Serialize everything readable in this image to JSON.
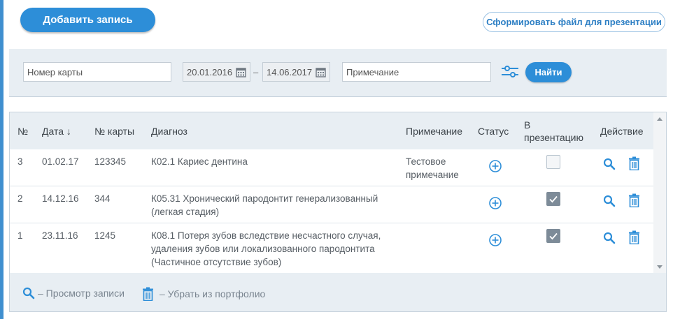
{
  "toolbar": {
    "add_label": "Добавить запись",
    "presentation_label": "Сформировать файл для презентации"
  },
  "filters": {
    "card_placeholder": "Номер карты",
    "date_from": "20.01.2016",
    "date_separator": "–",
    "date_to": "14.06.2017",
    "note_placeholder": "Примечание",
    "find_label": "Найти"
  },
  "table": {
    "headers": {
      "num": "№",
      "date": "Дата ↓",
      "card": "№ карты",
      "diagnosis": "Диагноз",
      "note": "Примечание",
      "status": "Статус",
      "presentation_line1": "В",
      "presentation_line2": "презентацию",
      "action": "Действие"
    },
    "rows": [
      {
        "num": "3",
        "date": "01.02.17",
        "card": "123345",
        "diagnosis_lines": [
          "К02.1 Кариес дентина"
        ],
        "note_lines": [
          "Тестовое",
          "примечание"
        ],
        "in_presentation": false
      },
      {
        "num": "2",
        "date": "14.12.16",
        "card": "344",
        "diagnosis_lines": [
          "К05.31 Хронический пародонтит генерализованный",
          "(легкая стадия)"
        ],
        "note_lines": [],
        "in_presentation": true
      },
      {
        "num": "1",
        "date": "23.11.16",
        "card": "1245",
        "diagnosis_lines": [
          "К08.1 Потеря зубов вследствие несчастного случая,",
          "удаления зубов или локализованного пародонтита",
          "(Частичное отсутствие зубов)"
        ],
        "note_lines": [],
        "in_presentation": true
      }
    ]
  },
  "legend": {
    "view_label": "– Просмотр записи",
    "remove_label": "– Убрать из портфолио"
  },
  "colors": {
    "accent": "#2d8ed8",
    "panel": "#e8eef3",
    "checkbox_checked": "#7d8b98"
  },
  "icons": {
    "calendar": "calendar-icon",
    "filter": "filter-sliders-icon",
    "status": "plus-circle-icon",
    "view": "search-icon",
    "delete": "trash-icon",
    "check": "check-icon"
  }
}
